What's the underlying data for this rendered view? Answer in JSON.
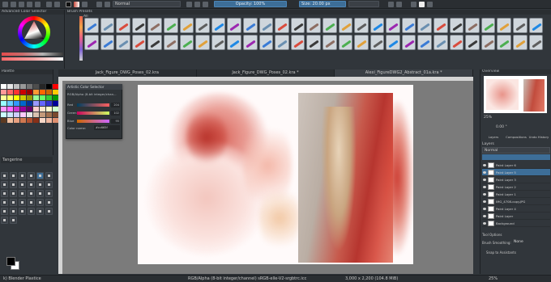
{
  "toolbar": {
    "blend_mode": "Normal",
    "opacity": "Opacity: 100%",
    "size": "Size: 20.00 px"
  },
  "color_selector": {
    "title": "Advanced Color Selector"
  },
  "brush_presets": {
    "title": "Brush Presets",
    "filter": "All",
    "count": 58
  },
  "tabs": [
    "Jack_Figure_DWG_Poses_02.kra",
    "Jack_Figure_DWG_Poses_02.kra *",
    "Alexi_FigureDWG2_Abstract_01a.kra *"
  ],
  "palette": {
    "title": "Palette",
    "current_color_name": "Tangerine",
    "swatches": [
      "#ffffff",
      "#e6e6e6",
      "#bfbfbf",
      "#999999",
      "#737373",
      "#4d4d4d",
      "#262626",
      "#000000",
      "#ff0000",
      "#ff9999",
      "#ff6666",
      "#ff3333",
      "#cc0000",
      "#990000",
      "#ff9933",
      "#ff6600",
      "#cc6600",
      "#ffcc00",
      "#ffff99",
      "#ffff66",
      "#ffff00",
      "#cccc00",
      "#999900",
      "#99ff99",
      "#66ff66",
      "#33cc33",
      "#009900",
      "#99ffff",
      "#66ccff",
      "#3399ff",
      "#0066cc",
      "#003399",
      "#9999ff",
      "#6666ff",
      "#3333cc",
      "#000099",
      "#ff99ff",
      "#ff66ff",
      "#cc33cc",
      "#990099",
      "#660066",
      "#ffcccc",
      "#ffe5cc",
      "#ffffcc",
      "#ccffcc",
      "#ccffff",
      "#cce5ff",
      "#ccccff",
      "#ffccff",
      "#e5e5e5",
      "#d9c2b0",
      "#c49a7a",
      "#a0704e",
      "#7a4a2e",
      "#5c3a22",
      "#f2c0a0",
      "#e8a080",
      "#d07850",
      "#b05030",
      "#883018",
      "#f8d8c8",
      "#f0b8a0",
      "#e09070"
    ]
  },
  "float_selector": {
    "title": "Artistic Color Selector",
    "subtitle": "RGB/Alpha (8-bit integer/chan...",
    "rows": [
      {
        "label": "Red",
        "value": "204",
        "gradient": "linear-gradient(90deg,#003f5f,#ff5f5f)"
      },
      {
        "label": "Green",
        "value": "102",
        "gradient": "linear-gradient(90deg,#cc005f,#ccff5f)"
      },
      {
        "label": "Blue",
        "value": "95",
        "gradient": "linear-gradient(90deg,#cc6600,#cc66ff)"
      }
    ],
    "color_name_label": "Color name:",
    "color_name_value": "#cc665f"
  },
  "right_dock": {
    "overview_title": "Overview",
    "zoom": "25%",
    "rotation": "0.00 °",
    "tabs": [
      "Layers",
      "Compositions",
      "Undo History"
    ],
    "layers_label": "Layers",
    "blend": "Normal",
    "layers": [
      {
        "name": "Paint Layer 6",
        "selected": false
      },
      {
        "name": "Paint Layer 5",
        "selected": true
      },
      {
        "name": "Paint Layer 3",
        "selected": false
      },
      {
        "name": "Paint Layer 2",
        "selected": false
      },
      {
        "name": "Paint Layer 1",
        "selected": false
      },
      {
        "name": "IMG_4708-copy.JPG",
        "selected": false
      },
      {
        "name": "Paint Layer 4",
        "selected": false
      },
      {
        "name": "Paint Layer",
        "selected": false
      },
      {
        "name": "Background",
        "selected": false
      }
    ],
    "tool_options": "Tool Options",
    "smoothing_label": "Brush Smoothing:",
    "smoothing_value": "None",
    "snap_label": "Snap to Assistants"
  },
  "status": {
    "brush": "k) Blender Plastice",
    "color_space": "RGB/Alpha (8-bit integer/channel)  sRGB-elle-V2-srgbtrc.icc",
    "dimensions": "3,000 x 2,200 (104.8 MiB)",
    "zoom": "25%"
  }
}
